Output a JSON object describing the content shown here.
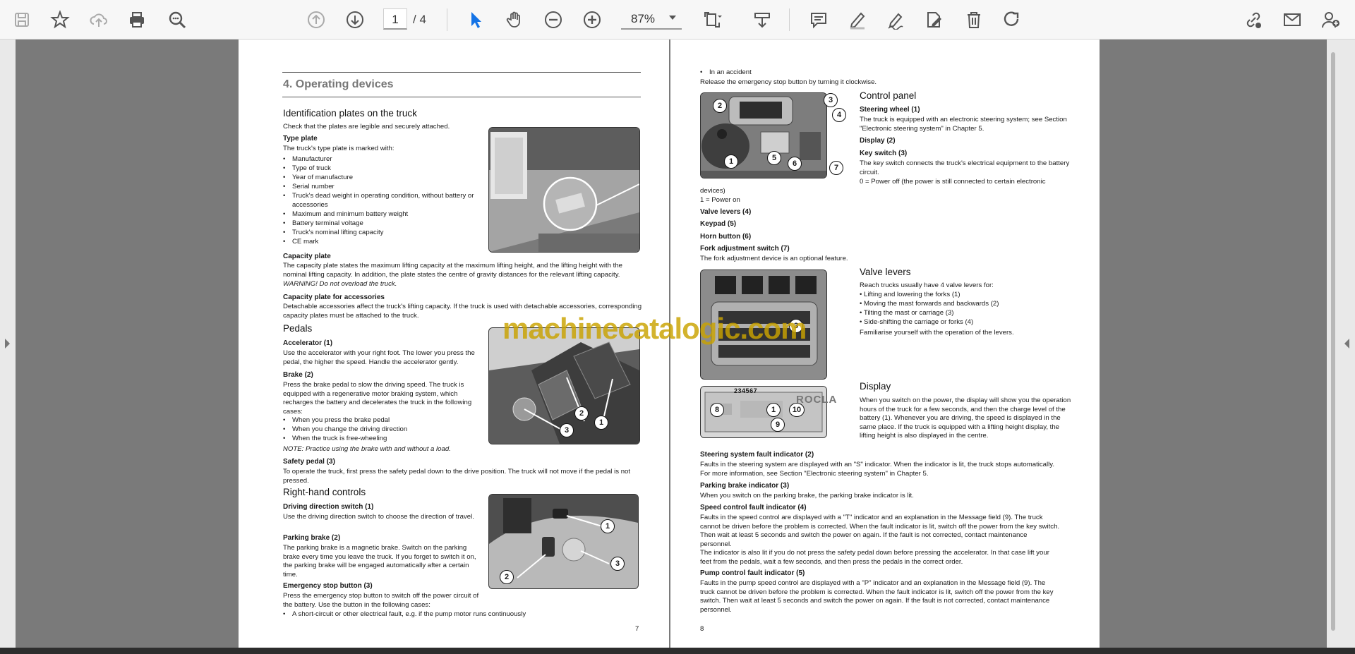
{
  "toolbar": {
    "page_current": "1",
    "page_total": "/ 4",
    "zoom": "87%",
    "icons": [
      "save-icon",
      "bookmark-star-icon",
      "cloud-upload-icon",
      "print-icon",
      "zoom-search-icon",
      "page-up-icon",
      "page-down-icon",
      "select-cursor-icon",
      "hand-icon",
      "zoom-out-icon",
      "zoom-in-icon",
      "fit-page-icon",
      "scroll-mode-icon",
      "comment-icon",
      "pen-icon",
      "sign-icon",
      "stamp-icon",
      "delete-icon",
      "redo-icon",
      "share-link-icon",
      "mail-icon",
      "add-user-icon"
    ]
  },
  "page1": {
    "chapter": "4.  Operating devices",
    "id_plates": {
      "heading": "Identification plates on the truck",
      "intro": "Check that the plates are legible and securely attached.",
      "type_plate_heading": "Type plate",
      "type_plate_intro": "The truck's type plate is marked with:",
      "items": [
        "Manufacturer",
        "Type of truck",
        "Year of manufacture",
        "Serial number",
        "Truck's dead weight in operating condition, without battery or accessories",
        "Maximum and minimum battery weight",
        "Battery terminal voltage",
        "Truck's nominal lifting capacity",
        "CE mark"
      ],
      "capacity_heading": "Capacity plate",
      "capacity_text": "The capacity plate states the maximum lifting capacity at the maximum lifting height, and the lifting height with the nominal lifting capacity. In addition, the plate states the centre of gravity distances for the relevant lifting capacity.",
      "capacity_warning": "WARNING! Do not overload the truck.",
      "accessories_heading": "Capacity plate for accessories",
      "accessories_text": "Detachable accessories affect the truck's lifting capacity. If the truck is used with detachable accessories, corresponding capacity plates must be attached to the truck."
    },
    "pedals": {
      "heading": "Pedals",
      "acc_heading": "Accelerator (1)",
      "acc_text": "Use the accelerator with your right foot. The lower you press the pedal, the higher the speed. Handle the accelerator gently.",
      "brake_heading": "Brake (2)",
      "brake_text": "Press the brake pedal to slow the driving speed. The truck is equipped with a regenerative motor braking system, which recharges the battery and decelerates the truck in the following cases:",
      "brake_items": [
        "When you press the brake pedal",
        "When you change the driving direction",
        "When the truck is free-wheeling"
      ],
      "brake_note": "NOTE: Practice using the brake with and without a load.",
      "safety_heading": "Safety pedal (3)",
      "safety_text": "To operate the truck, first press the safety pedal down to the drive position. The truck will not move if the pedal is not pressed."
    },
    "rh_controls": {
      "heading": "Right-hand controls",
      "dir_heading": "Driving direction switch (1)",
      "dir_text": "Use the driving direction switch to choose the direction of travel.",
      "park_heading": "Parking brake (2)",
      "park_text": "The parking brake is a magnetic brake. Switch on the parking brake every time you leave the truck. If you forget to switch it on, the parking brake will be engaged automatically after a certain time.",
      "estop_heading": "Emergency stop button (3)",
      "estop_text": "Press the emergency stop button to switch off the power circuit of the battery. Use the button in the following cases:",
      "estop_items": [
        "A short-circuit or other electrical fault, e.g. if the pump motor runs continuously"
      ]
    },
    "photo_numbers": {
      "pedals": [
        "2",
        "3",
        "1"
      ],
      "rh": [
        "1",
        "2",
        "3"
      ]
    },
    "page_number": "7"
  },
  "page2": {
    "top_items": [
      "In an accident"
    ],
    "release_text": "Release the emergency stop button by turning it clockwise.",
    "control_panel": {
      "heading": "Control panel",
      "steer_heading": "Steering wheel (1)",
      "steer_text": "The truck is equipped with an electronic steering system; see Section \"Electronic steering system\" in Chapter 5.",
      "display_heading": "Display (2)",
      "key_heading": "Key switch (3)",
      "key_text": "The key switch connects the truck's electrical equipment to the battery circuit.",
      "key_off": "0 = Power off (the power is still connected to certain electronic",
      "key_off_cont": "devices)",
      "key_on": "1 = Power on",
      "valve_heading": "Valve levers (4)",
      "keypad_heading": "Keypad (5)",
      "horn_heading": "Horn button (6)",
      "fork_heading": "Fork adjustment switch (7)",
      "fork_text": "The fork adjustment device is an optional feature."
    },
    "valve_levers": {
      "heading": "Valve levers",
      "intro": "Reach trucks usually have 4 valve levers for:",
      "items": [
        "• Lifting and lowering the forks (1)",
        "• Moving the mast forwards and backwards (2)",
        "• Tilting the mast or carriage (3)",
        "• Side-shifting the carriage or forks (4)"
      ],
      "outro": "Familiarise yourself with the operation of the levers."
    },
    "display": {
      "heading": "Display",
      "text": "When you switch on the power, the display will show you the operation hours of the truck for a few seconds, and then the charge level of the battery (1). Whenever you are driving, the speed is displayed in the same place. If the truck is equipped with a lifting height display, the lifting height is also displayed in the centre.",
      "steer_fault_heading": "Steering system fault indicator (2)",
      "steer_fault_text": "Faults in the steering system are displayed with an \"S\" indicator. When the indicator is lit, the truck stops automatically. For more information, see Section \"Electronic steering system\" in Chapter 5.",
      "park_ind_heading": "Parking brake indicator (3)",
      "park_ind_text": "When you switch on the parking brake, the parking brake indicator is lit.",
      "speed_fault_heading": "Speed control fault indicator (4)",
      "speed_fault_text": "Faults in the speed control are displayed with a \"T\" indicator and an explanation in the Message field (9). The truck cannot be driven before the problem is corrected. When the fault indicator is lit, switch off the power from the key switch. Then wait at least 5 seconds and switch the power on again. If the fault is not corrected, contact maintenance personnel.",
      "speed_fault_text2": "The indicator is also lit if you do not press the safety pedal down before pressing the accelerator. In that case lift your feet from the pedals, wait a few seconds, and then press the pedals in the correct order.",
      "pump_fault_heading": "Pump control fault indicator (5)",
      "pump_fault_text": "Faults in the pump speed control are displayed with a \"P\" indicator and an explanation in the Message field (9). The truck cannot be driven before the problem is corrected. When the fault indicator is lit, switch off the power from the key switch. Then wait at least 5 seconds and switch the power on again. If the fault is not corrected, contact maintenance personnel."
    },
    "photo_numbers": {
      "panel": [
        "2",
        "3",
        "4",
        "1",
        "5",
        "6",
        "7"
      ],
      "levers": [
        "3"
      ],
      "display": [
        "2",
        "3",
        "4",
        "5",
        "6",
        "7",
        "8",
        "1",
        "10",
        "9"
      ],
      "display_brand": "ROCLA"
    },
    "page_number": "8"
  },
  "watermark": "machinecatalogic.com"
}
